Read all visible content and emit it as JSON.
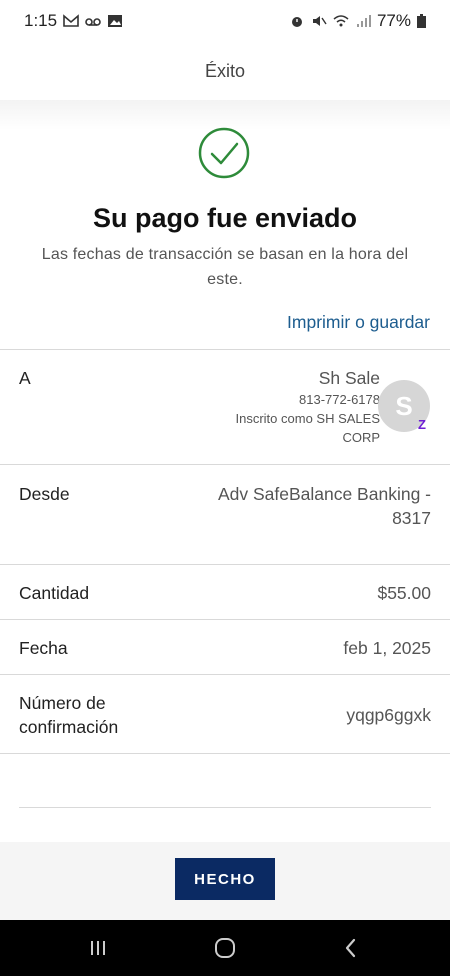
{
  "status_bar": {
    "time": "1:15",
    "battery": "77%",
    "left_icons": [
      "gmail-icon",
      "voicemail-icon",
      "gallery-icon"
    ],
    "right_icons": [
      "alarm-icon",
      "mute-icon",
      "wifi-icon",
      "signal-icon",
      "battery-icon"
    ]
  },
  "app_bar": {
    "title": "Éxito"
  },
  "hero": {
    "icon": "check-circle-icon",
    "title": "Su pago fue enviado",
    "subtitle": "Las fechas de transacción se basan en la hora del este.",
    "print_link": "Imprimir o guardar"
  },
  "details": {
    "to": {
      "label": "A",
      "name": "Sh Sale",
      "phone": "813-772-6178",
      "enrolled_line1": "Inscrito como SH SALES",
      "enrolled_line2": "CORP",
      "avatar_initial": "S",
      "badge": "Z"
    },
    "from": {
      "label": "Desde",
      "value_line1": "Adv SafeBalance Banking -",
      "value_line2": "8317"
    },
    "amount": {
      "label": "Cantidad",
      "value": "$55.00"
    },
    "date": {
      "label": "Fecha",
      "value": "feb 1, 2025"
    },
    "confirmation": {
      "label_line1": "Número de",
      "label_line2": "confirmación",
      "value": "yqgp6ggxk"
    }
  },
  "actions": {
    "done_label": "HECHO"
  },
  "nav_bar": {
    "icons": [
      "recent-apps-icon",
      "home-icon",
      "back-icon"
    ]
  },
  "colors": {
    "accent": "#1d5d8f",
    "button": "#0b2a63",
    "success": "#2e8b3a",
    "zelle": "#6d1ed4"
  }
}
